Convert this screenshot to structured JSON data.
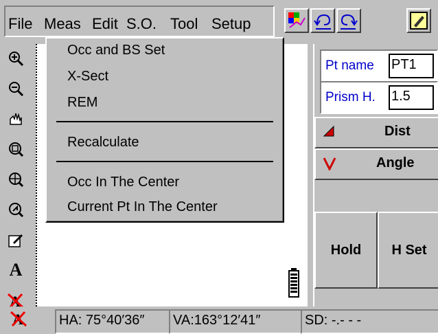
{
  "menubar": {
    "items": [
      "File",
      "Meas",
      "Edit",
      "S.O.",
      "Tool",
      "Setup"
    ]
  },
  "toolbar": {
    "icons": [
      "layer-color-icon",
      "undo-icon",
      "redo-icon",
      "pen-icon"
    ]
  },
  "left_tools": [
    "zoom-in-icon",
    "zoom-out-icon",
    "pan-hand-icon",
    "zoom-window-icon",
    "zoom-extents-icon",
    "zoom-point-icon",
    "edit-icon",
    "text-icon",
    "erase-text-icon"
  ],
  "meas_menu": {
    "items": [
      "Occ and BS Set",
      "X-Sect",
      "REM",
      "Recalculate",
      "Occ In The Center",
      "Current Pt In The Center"
    ]
  },
  "right_panel": {
    "pt_name_label": "Pt name",
    "pt_name_value": "PT1",
    "prism_h_label": "Prism H.",
    "prism_h_value": "1.5",
    "dist_label": "Dist",
    "angle_label": "Angle",
    "hold_label": "Hold",
    "hset_label": "H Set"
  },
  "status": {
    "ha": "HA: 75°40′36″",
    "va": "VA:163°12′41″",
    "sd": "SD:    -.- - -"
  }
}
